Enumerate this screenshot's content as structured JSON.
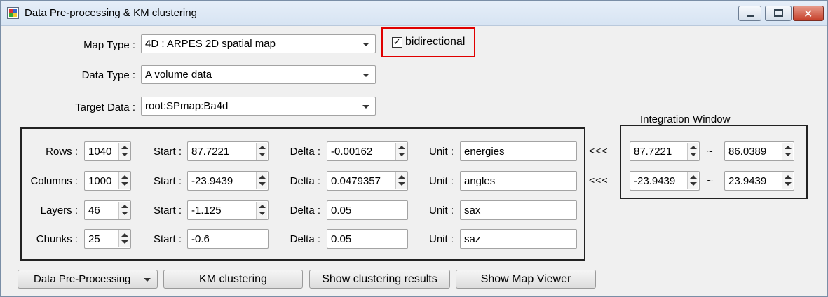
{
  "window": {
    "title": "Data Pre-processing & KM clustering",
    "controls": [
      "minimize",
      "maximize",
      "close"
    ]
  },
  "map_type": {
    "label": "Map Type :",
    "value": "4D : ARPES 2D spatial map"
  },
  "data_type": {
    "label": "Data Type :",
    "value": "A volume data"
  },
  "target_data": {
    "label": "Target Data :",
    "value": "root:SPmap:Ba4d"
  },
  "bidirectional": {
    "label": "bidirectional",
    "checked": true,
    "check_glyph": "✓"
  },
  "params": {
    "rows": {
      "label": "Rows :",
      "count": "1040",
      "start_label": "Start :",
      "start": "87.7221",
      "delta_label": "Delta :",
      "delta": "-0.00162",
      "unit_label": "Unit :",
      "unit": "energies"
    },
    "columns": {
      "label": "Columns :",
      "count": "1000",
      "start_label": "Start :",
      "start": "-23.9439",
      "delta_label": "Delta :",
      "delta": "0.0479357",
      "unit_label": "Unit :",
      "unit": "angles"
    },
    "layers": {
      "label": "Layers :",
      "count": "46",
      "start_label": "Start :",
      "start": "-1.125",
      "delta_label": "Delta :",
      "delta": "0.05",
      "unit_label": "Unit :",
      "unit": "sax"
    },
    "chunks": {
      "label": "Chunks :",
      "count": "25",
      "start_label": "Start :",
      "start": "-0.6",
      "delta_label": "Delta :",
      "delta": "0.05",
      "unit_label": "Unit :",
      "unit": "saz"
    }
  },
  "integration": {
    "title": "Integration Window",
    "copy_glyph": "<<<",
    "sep_glyph": "~",
    "rows": {
      "from": "87.7221",
      "to": "86.0389"
    },
    "columns": {
      "from": "-23.9439",
      "to": "23.9439"
    }
  },
  "buttons": {
    "preprocessing": "Data Pre-Processing",
    "km_clustering": "KM clustering",
    "show_results": "Show clustering results",
    "show_viewer": "Show Map Viewer"
  },
  "colors": {
    "highlight_border": "#e00000",
    "window_bg": "#f0f0f0"
  }
}
